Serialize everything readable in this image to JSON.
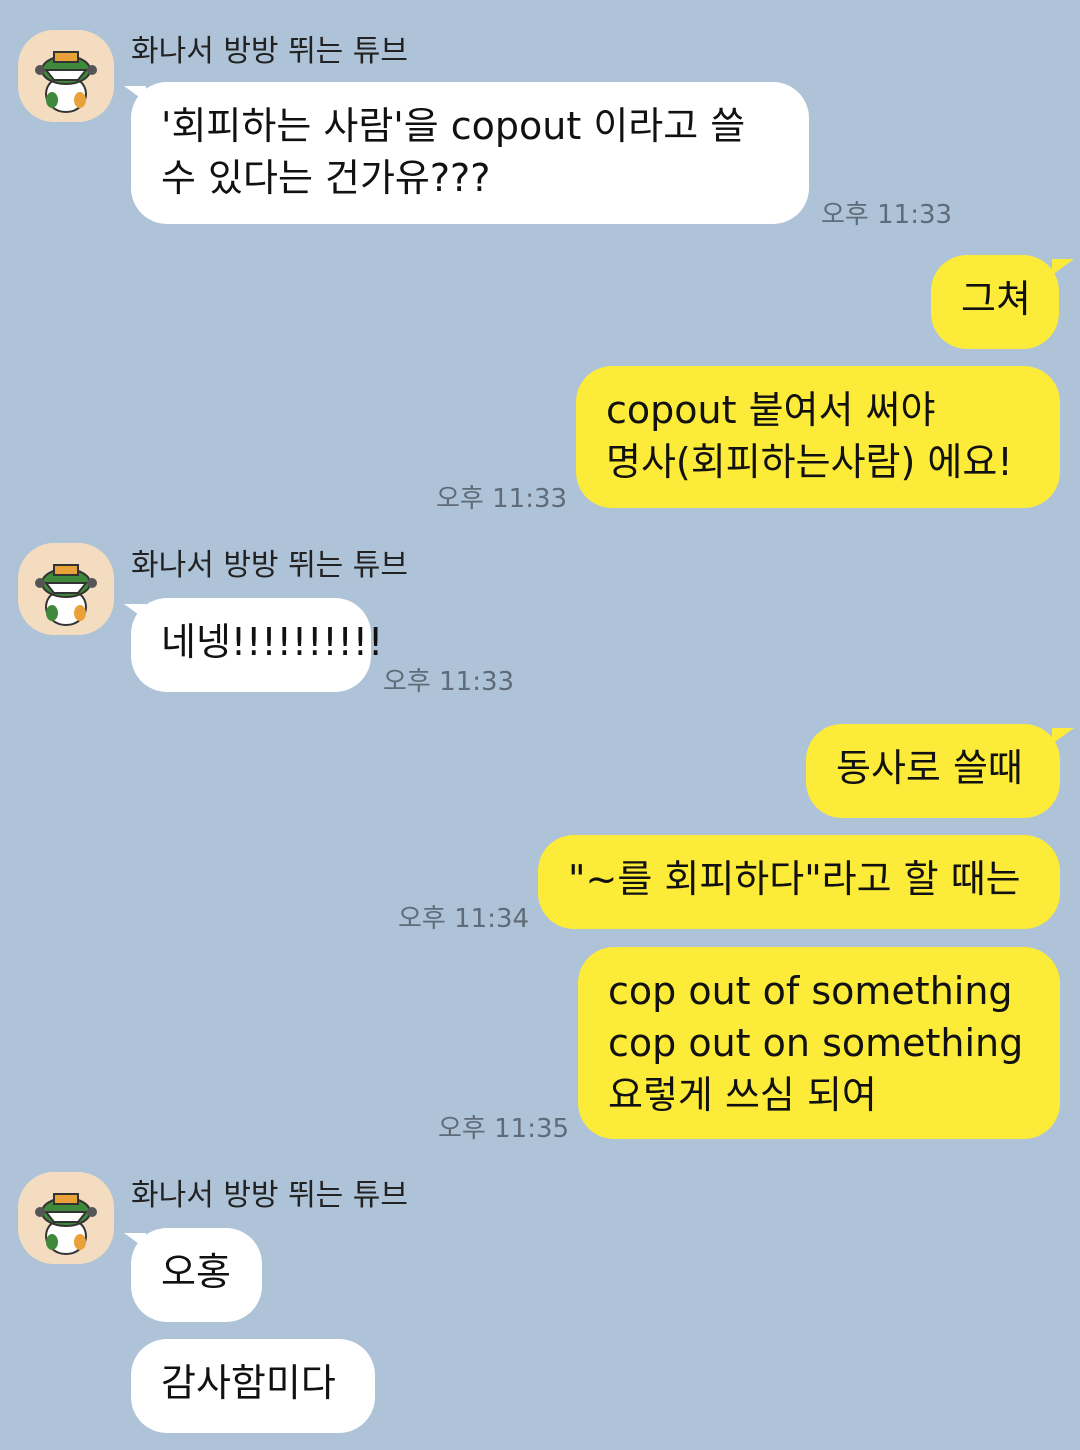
{
  "sender_name": "화나서 방방 뛰는 튜브",
  "avatar_icon": "angry-duck-avatar-icon",
  "colors": {
    "background": "#aec3d8",
    "incoming_bubble": "#ffffff",
    "outgoing_bubble": "#fdeb39"
  },
  "messages": [
    {
      "lines": [
        "'회피하는 사람'을 copout 이라고 쓸",
        "수 있다는 건가유???"
      ],
      "time": "오후 11:33"
    },
    {
      "lines": [
        "그쳐"
      ]
    },
    {
      "lines": [
        "copout 붙여서 써야",
        "명사(회피하는사람) 에요!"
      ],
      "time": "오후 11:33"
    },
    {
      "lines": [
        "네넹!!!!!!!!!!"
      ],
      "time": "오후 11:33"
    },
    {
      "lines": [
        "동사로 쓸때"
      ]
    },
    {
      "lines": [
        "\"~를 회피하다\"라고 할 때는"
      ],
      "time": "오후 11:34"
    },
    {
      "lines": [
        "cop out of something",
        "cop out on something",
        "요렇게 쓰심 되여"
      ],
      "time": "오후 11:35"
    },
    {
      "lines": [
        "오홍"
      ]
    },
    {
      "lines": [
        "감사함미다"
      ]
    }
  ]
}
